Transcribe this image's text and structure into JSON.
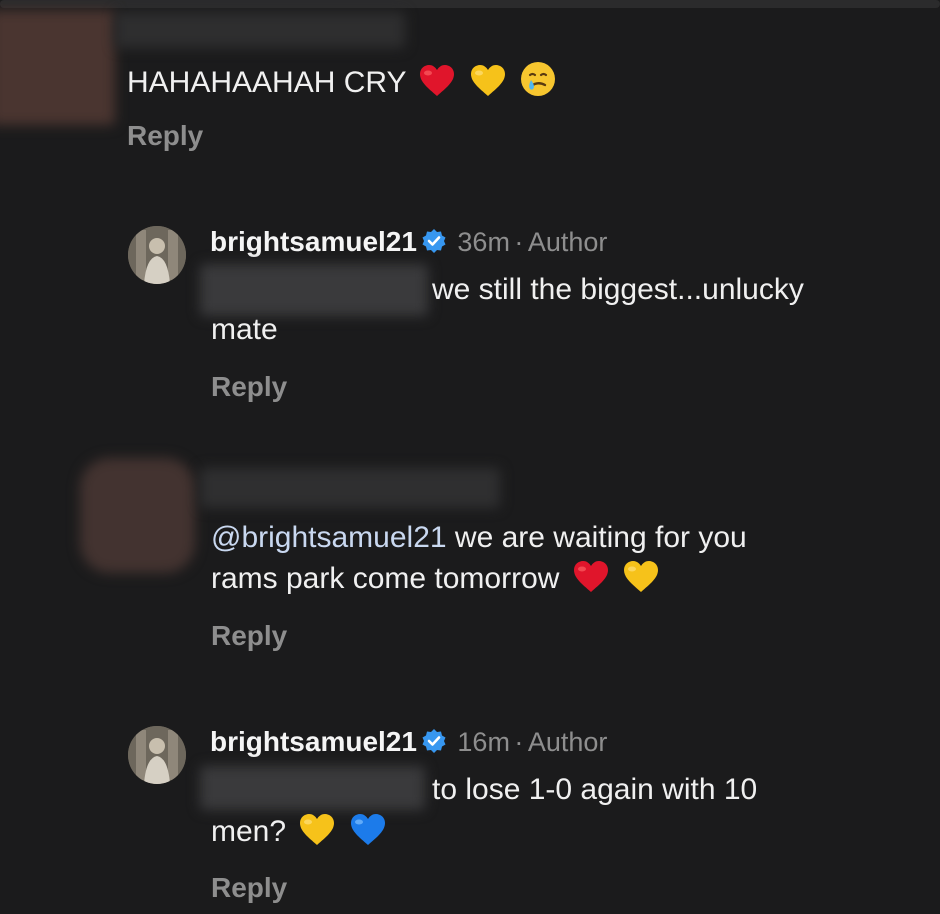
{
  "comments": [
    {
      "text": "HAHAHAAHAH CRY",
      "emojis": [
        "red-heart-icon",
        "yellow-heart-icon",
        "crying-face-icon"
      ],
      "reply_label": "Reply"
    },
    {
      "username": "brightsamuel21",
      "verified": true,
      "time": "36m",
      "separator": "·",
      "role": "Author",
      "text_line1": "we still the biggest...unlucky",
      "text_line2": "mate",
      "reply_label": "Reply"
    },
    {
      "mention": "@brightsamuel21",
      "text_line1": " we are waiting for you",
      "text_line2": "rams park come tomorrow",
      "emojis": [
        "red-heart-icon",
        "yellow-heart-icon"
      ],
      "reply_label": "Reply"
    },
    {
      "username": "brightsamuel21",
      "verified": true,
      "time": "16m",
      "separator": "·",
      "role": "Author",
      "text_line1": "to lose 1-0 again with 10",
      "text_line2": "men?",
      "emojis": [
        "yellow-heart-icon",
        "blue-heart-icon"
      ],
      "reply_label": "Reply"
    }
  ],
  "colors": {
    "background": "#1b1b1c",
    "text": "#f0f0f0",
    "secondary": "#8e8e8e",
    "verified": "#3797f0",
    "heart_red": "#e0152b",
    "heart_yellow": "#f6c21a",
    "heart_blue": "#1c7bea"
  }
}
